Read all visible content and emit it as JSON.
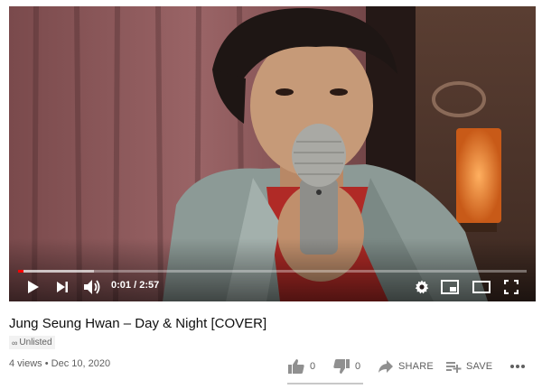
{
  "player": {
    "progress_fraction": 0.006,
    "time_current": "0:01",
    "time_separator": "/",
    "time_total": "2:57",
    "accent_color": "#ff0000",
    "controls": {
      "play_icon": "play-icon",
      "next_icon": "skip-next-icon",
      "volume_icon": "volume-icon",
      "settings_icon": "gear-icon",
      "miniplayer_icon": "miniplayer-icon",
      "theater_icon": "theater-mode-icon",
      "fullscreen_icon": "fullscreen-icon"
    }
  },
  "video": {
    "title": "Jung Seung Hwan – Day & Night [COVER]",
    "privacy_badge": "Unlisted",
    "privacy_icon": "link-icon",
    "views": "4 views",
    "separator": "•",
    "date": "Dec 10, 2020"
  },
  "actions": {
    "like_count": "0",
    "dislike_count": "0",
    "share_label": "SHARE",
    "save_label": "SAVE",
    "like_icon": "thumbs-up-icon",
    "dislike_icon": "thumbs-down-icon",
    "share_icon": "share-arrow-icon",
    "save_icon": "playlist-add-icon",
    "more_icon": "more-horizontal-icon"
  }
}
